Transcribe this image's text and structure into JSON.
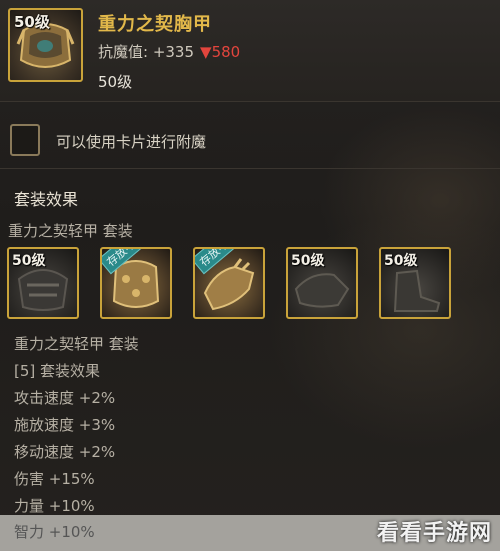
{
  "item": {
    "level_badge": "50级",
    "name": "重力之契胸甲",
    "stat_label": "抗魔值: +335",
    "stat_down": "▼580",
    "level": "50级"
  },
  "card": {
    "label": "可以使用卡片进行附魔"
  },
  "set": {
    "section_title": "套装效果",
    "set_name": "重力之契轻甲 套装",
    "slots": [
      {
        "badge": "50级",
        "ribbon": ""
      },
      {
        "badge": "",
        "ribbon": "存放中"
      },
      {
        "badge": "",
        "ribbon": "存放中"
      },
      {
        "badge": "50级",
        "ribbon": ""
      },
      {
        "badge": "50级",
        "ribbon": ""
      }
    ],
    "lines": [
      "重力之契轻甲 套装",
      "[5] 套装效果",
      "攻击速度 +2%",
      "施放速度 +3%",
      "移动速度 +2%",
      "伤害 +15%",
      "力量 +10%"
    ],
    "last_line": "智力 +10%"
  },
  "watermark": "看看手游网",
  "colors": {
    "gold_name": "#e2b84a",
    "down_red": "#e2453d",
    "slot_border": "#c9a33a",
    "ribbon_teal": "#2a8a8a"
  }
}
